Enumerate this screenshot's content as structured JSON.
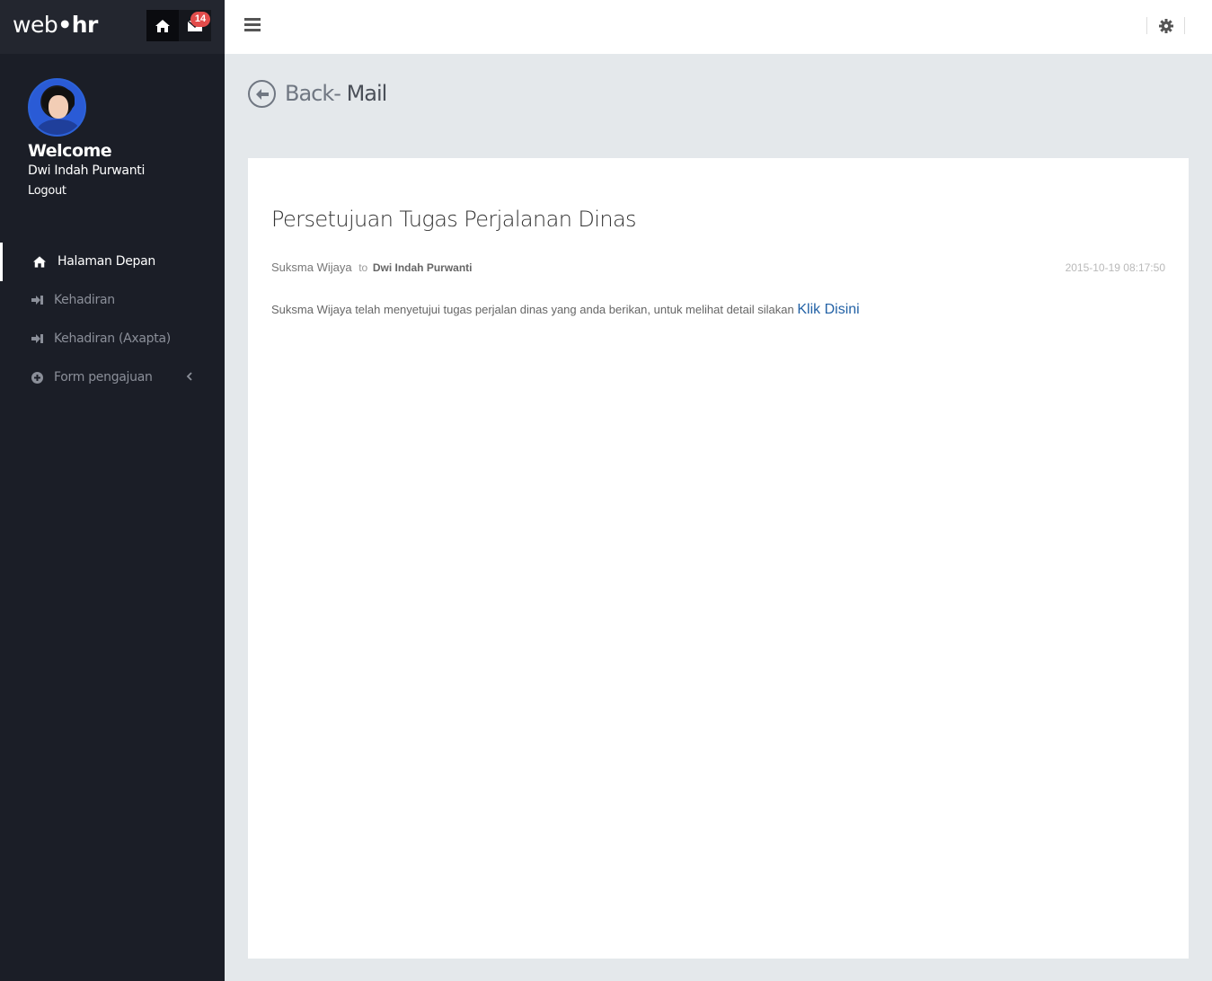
{
  "brand": {
    "logo_web": "web",
    "logo_dot": "•",
    "logo_hr": "hr"
  },
  "header": {
    "mail_badge": "14"
  },
  "profile": {
    "welcome": "Welcome",
    "name": "Dwi Indah Purwanti",
    "logout": "Logout"
  },
  "nav": {
    "items": [
      {
        "label": "Halaman Depan",
        "icon": "home-icon",
        "active": true
      },
      {
        "label": "Kehadiran",
        "icon": "sign-in-icon"
      },
      {
        "label": "Kehadiran (Axapta)",
        "icon": "sign-in-icon"
      },
      {
        "label": "Form pengajuan",
        "icon": "plus-circle-icon",
        "has_submenu": true
      }
    ]
  },
  "page": {
    "back_label": "Back-",
    "title": "Mail"
  },
  "mail": {
    "subject": "Persetujuan Tugas Perjalanan Dinas",
    "sender": "Suksma Wijaya",
    "to_label": "to",
    "recipient": "Dwi Indah Purwanti",
    "date": "2015-10-19 08:17:50",
    "body": "Suksma Wijaya telah menyetujui tugas perjalan dinas yang anda berikan, untuk melihat detail silakan",
    "link_text": "Klik Disini"
  },
  "colors": {
    "sidebar_bg": "#1b1e27",
    "badge": "#e24c4b",
    "link": "#2362a6",
    "content_bg": "#e4e8eb"
  }
}
